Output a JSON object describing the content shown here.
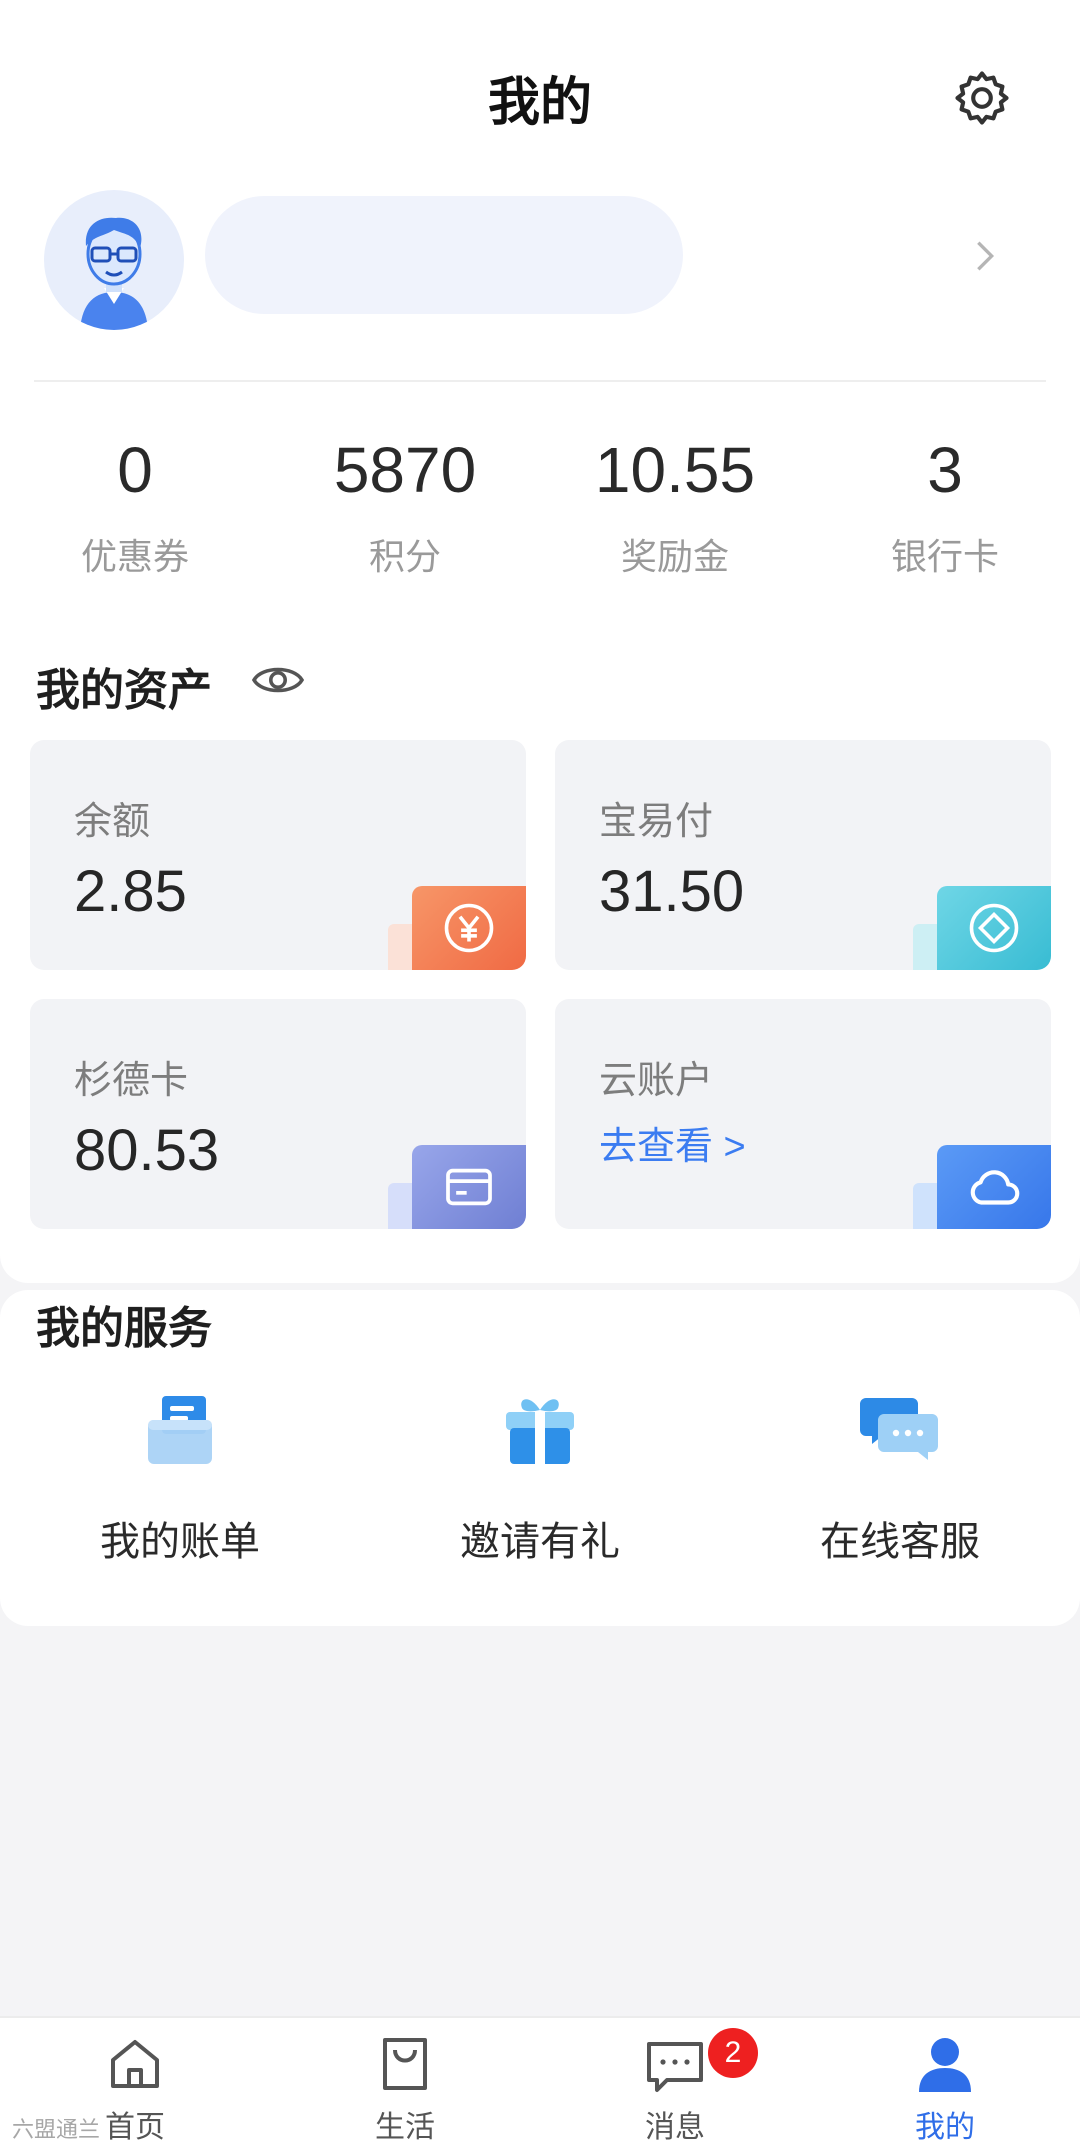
{
  "header": {
    "title": "我的",
    "settings_icon": "gear-icon"
  },
  "profile": {
    "avatar_icon": "user-avatar-icon",
    "name": "",
    "arrow_icon": "chevron-right-icon"
  },
  "stats": [
    {
      "value": "0",
      "label": "优惠券"
    },
    {
      "value": "5870",
      "label": "积分"
    },
    {
      "value": "10.55",
      "label": "奖励金"
    },
    {
      "value": "3",
      "label": "银行卡"
    }
  ],
  "assets": {
    "title": "我的资产",
    "eye_icon": "eye-icon",
    "items": [
      {
        "label": "余额",
        "value": "2.85",
        "icon": "yen-coin-icon",
        "color": "#f4774f"
      },
      {
        "label": "宝易付",
        "value": "31.50",
        "icon": "diamond-icon",
        "color": "#49c6da"
      },
      {
        "label": "杉德卡",
        "value": "80.53",
        "icon": "card-icon",
        "color": "#7b8ad9"
      },
      {
        "label": "云账户",
        "link": "去查看 >",
        "icon": "cloud-icon",
        "color": "#3f84f0"
      }
    ]
  },
  "services": {
    "title": "我的服务",
    "items": [
      {
        "label": "我的账单",
        "icon": "bill-icon"
      },
      {
        "label": "邀请有礼",
        "icon": "gift-icon"
      },
      {
        "label": "在线客服",
        "icon": "chat-bubbles-icon"
      }
    ]
  },
  "tabbar": {
    "items": [
      {
        "label": "首页",
        "icon": "home-icon"
      },
      {
        "label": "生活",
        "icon": "shopping-bag-icon"
      },
      {
        "label": "消息",
        "icon": "message-icon",
        "badge": "2"
      },
      {
        "label": "我的",
        "icon": "user-icon",
        "active": true
      }
    ]
  },
  "watermark": "六盟通兰"
}
